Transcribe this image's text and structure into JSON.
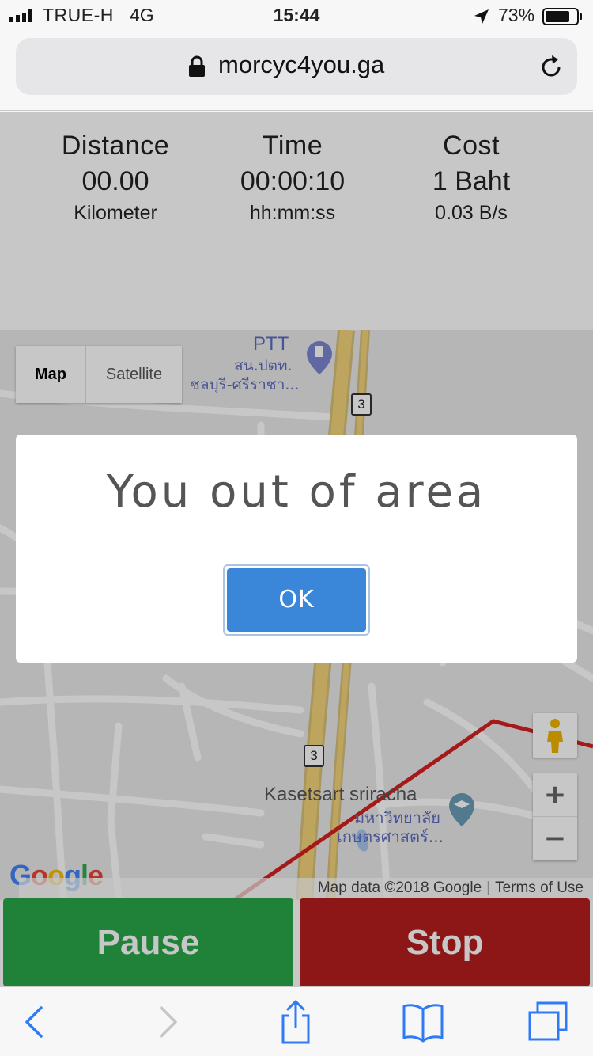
{
  "status_bar": {
    "carrier": "TRUE-H",
    "network": "4G",
    "time": "15:44",
    "battery_percent": "73%"
  },
  "address_bar": {
    "url": "morcyc4you.ga"
  },
  "stats": {
    "distance": {
      "label": "Distance",
      "value": "00.00",
      "unit": "Kilometer"
    },
    "time": {
      "label": "Time",
      "value": "00:00:10",
      "unit": "hh:mm:ss"
    },
    "cost": {
      "label": "Cost",
      "value": "1 Baht",
      "unit": "0.03 B/s"
    }
  },
  "map": {
    "type_tabs": {
      "map": "Map",
      "satellite": "Satellite"
    },
    "poi_ptt": "PTT",
    "poi_ptt_thai_1": "สน.ปตท.",
    "poi_ptt_thai_2": "ชลบุรี-ศรีราชา...",
    "poi_kasetsart": "Kasetsart sriracha",
    "poi_kasetsart_thai_1": "มหาวิทยาลัย",
    "poi_kasetsart_thai_2": "เกษตรศาสตร์...",
    "road_number": "3",
    "zoom_in": "+",
    "zoom_out": "−",
    "google_logo": "Google",
    "map_data": "Map data ©2018 Google",
    "terms": "Terms of Use"
  },
  "controls": {
    "pause": "Pause",
    "stop": "Stop"
  },
  "modal": {
    "message": "You out of area",
    "ok_label": "OK"
  },
  "colors": {
    "pause": "#2aa748",
    "stop": "#b51e1e",
    "ok_button": "#3a86d8",
    "route": "#d42020",
    "highway": "#f2d27a"
  }
}
